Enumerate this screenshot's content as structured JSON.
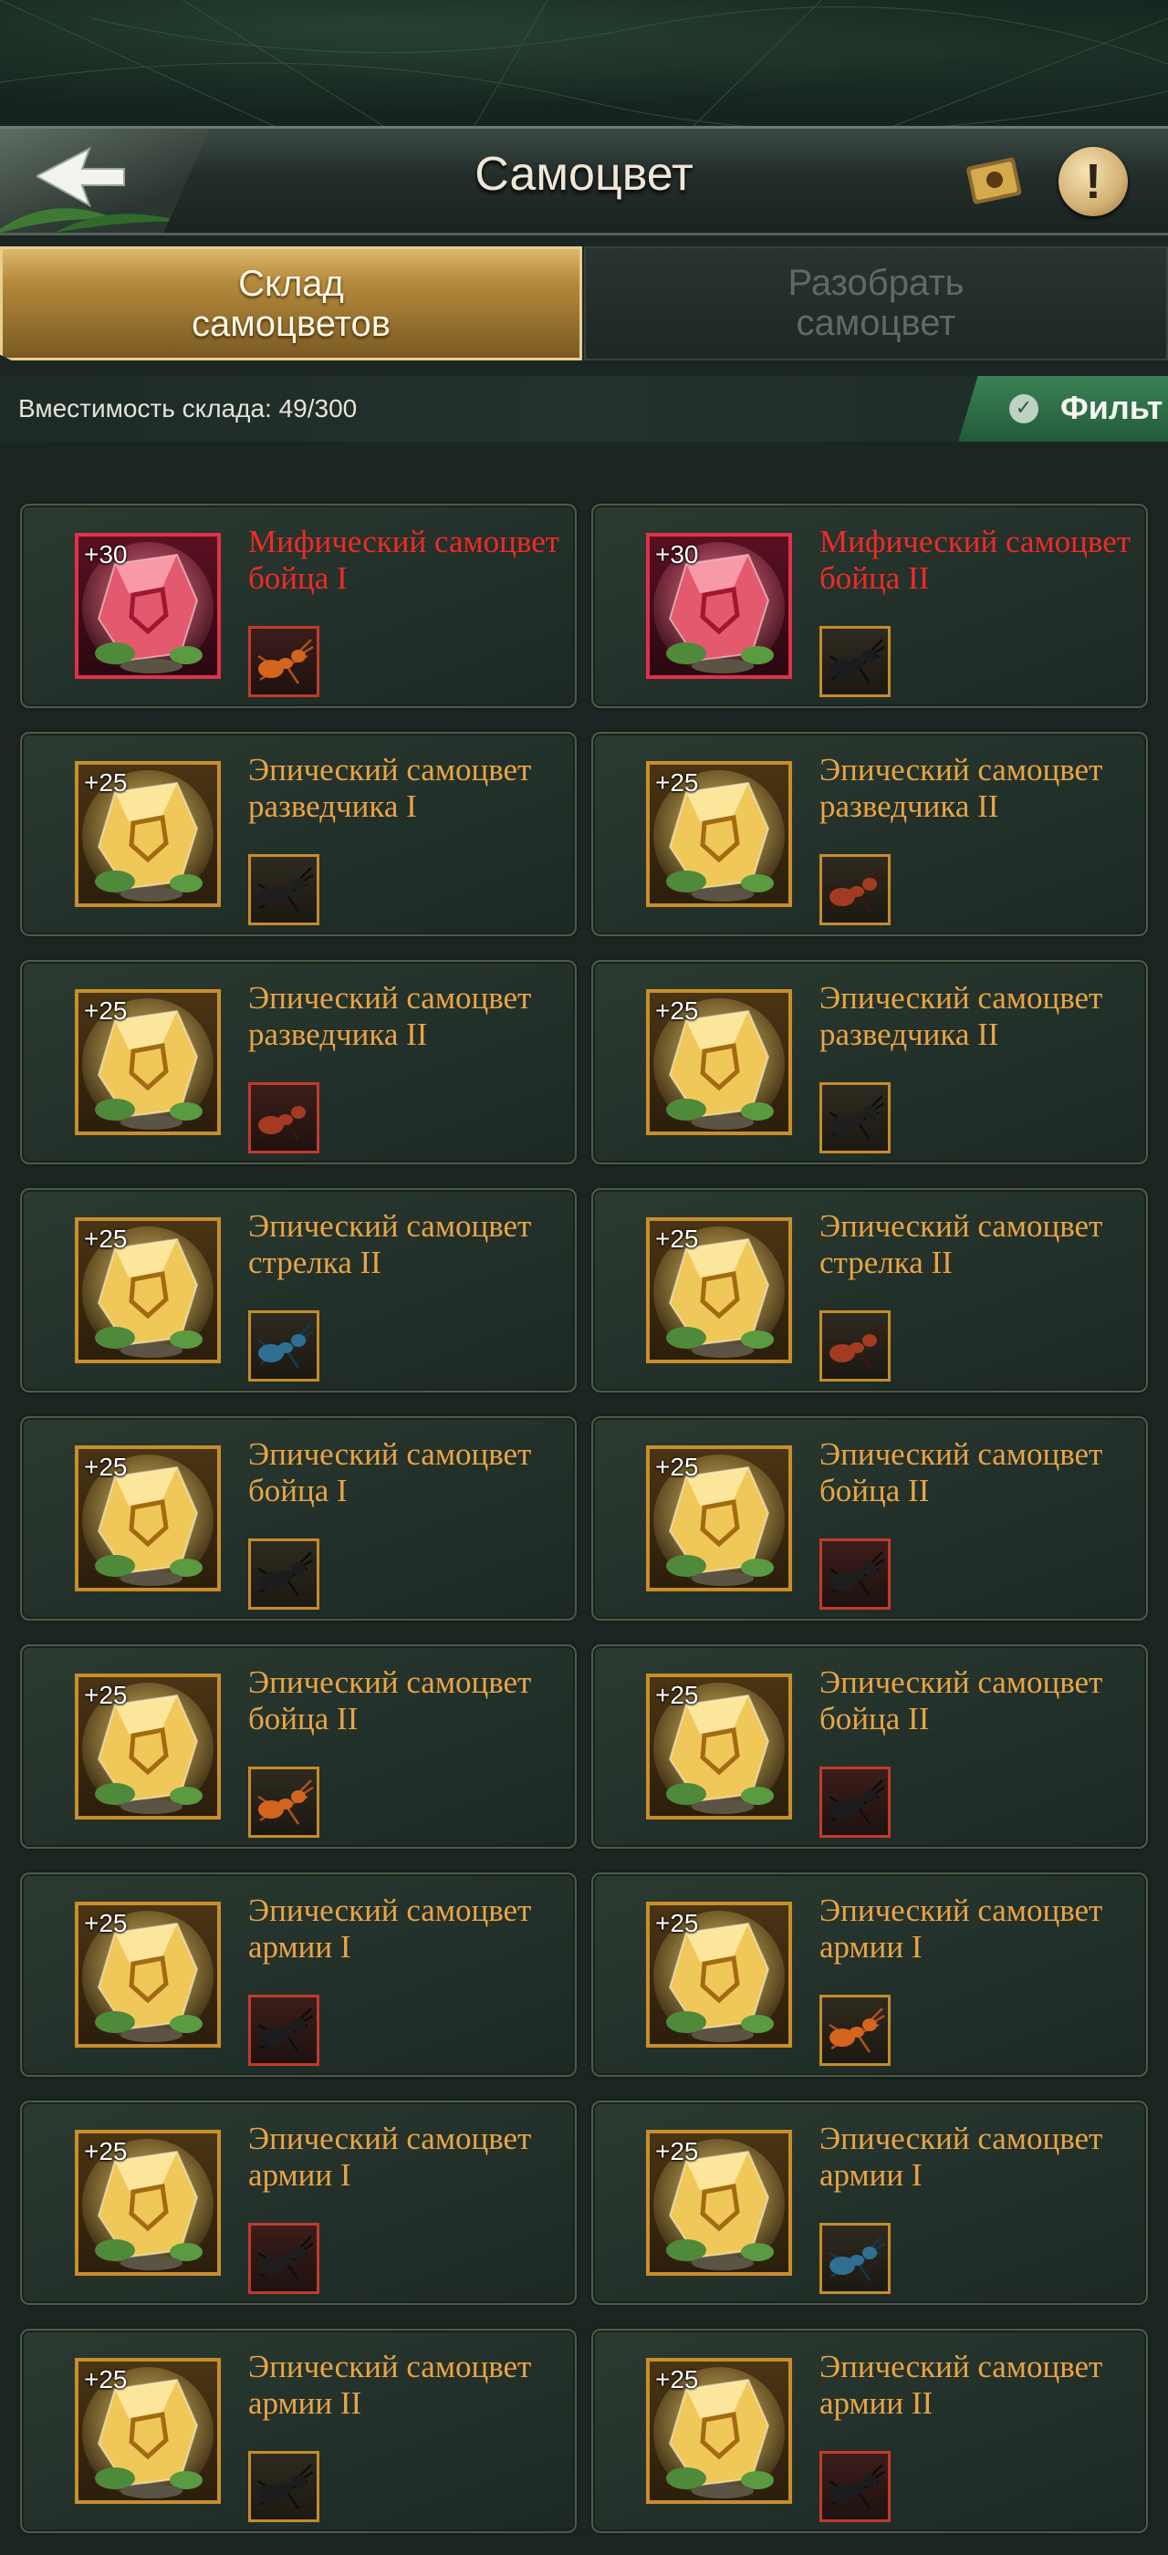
{
  "header": {
    "title": "Самоцвет"
  },
  "tabs": [
    {
      "label": "Склад\nсамоцветов",
      "active": true
    },
    {
      "label": "Разобрать\nсамоцвет",
      "active": false
    }
  ],
  "storage": {
    "capacity_text": "Вместимость склада: 49/300"
  },
  "filter": {
    "label": "Фильт"
  },
  "colors": {
    "epic": "#e9a445",
    "mythic": "#ef2a26",
    "tab_gold": "#c9a050",
    "filter_green": "#2e6e48"
  },
  "gems": [
    {
      "level": "+30",
      "name": "Мифический самоцвет бойца I",
      "rarity": "mythic",
      "insect_frame": "red",
      "insect": "orange-ant"
    },
    {
      "level": "+30",
      "name": "Мифический самоцвет бойца II",
      "rarity": "mythic",
      "insect_frame": "gold",
      "insect": "black-beetle"
    },
    {
      "level": "+25",
      "name": "Эпический самоцвет разведчика I",
      "rarity": "epic",
      "insect_frame": "gold",
      "insect": "black-ant"
    },
    {
      "level": "+25",
      "name": "Эпический самоцвет разведчика II",
      "rarity": "epic",
      "insect_frame": "gold",
      "insect": "red-ant"
    },
    {
      "level": "+25",
      "name": "Эпический самоцвет разведчика II",
      "rarity": "epic",
      "insect_frame": "red",
      "insect": "red-ant"
    },
    {
      "level": "+25",
      "name": "Эпический самоцвет разведчика II",
      "rarity": "epic",
      "insect_frame": "gold",
      "insect": "black-ant"
    },
    {
      "level": "+25",
      "name": "Эпический самоцвет стрелка II",
      "rarity": "epic",
      "insect_frame": "gold",
      "insect": "blue-beetle"
    },
    {
      "level": "+25",
      "name": "Эпический самоцвет стрелка II",
      "rarity": "epic",
      "insect_frame": "gold",
      "insect": "red-ant"
    },
    {
      "level": "+25",
      "name": "Эпический самоцвет бойца I",
      "rarity": "epic",
      "insect_frame": "gold",
      "insect": "black-beetle"
    },
    {
      "level": "+25",
      "name": "Эпический самоцвет бойца II",
      "rarity": "epic",
      "insect_frame": "red",
      "insect": "black-ant"
    },
    {
      "level": "+25",
      "name": "Эпический самоцвет бойца II",
      "rarity": "epic",
      "insect_frame": "gold",
      "insect": "orange-ant"
    },
    {
      "level": "+25",
      "name": "Эпический самоцвет бойца II",
      "rarity": "epic",
      "insect_frame": "red",
      "insect": "black-beetle"
    },
    {
      "level": "+25",
      "name": "Эпический самоцвет армии I",
      "rarity": "epic",
      "insect_frame": "red",
      "insect": "black-beetle"
    },
    {
      "level": "+25",
      "name": "Эпический самоцвет армии I",
      "rarity": "epic",
      "insect_frame": "gold",
      "insect": "orange-ant"
    },
    {
      "level": "+25",
      "name": "Эпический самоцвет армии I",
      "rarity": "epic",
      "insect_frame": "red",
      "insect": "black-ant"
    },
    {
      "level": "+25",
      "name": "Эпический самоцвет армии I",
      "rarity": "epic",
      "insect_frame": "gold",
      "insect": "blue-beetle"
    },
    {
      "level": "+25",
      "name": "Эпический самоцвет армии II",
      "rarity": "epic",
      "insect_frame": "gold",
      "insect": "black-beetle"
    },
    {
      "level": "+25",
      "name": "Эпический самоцвет армии II",
      "rarity": "epic",
      "insect_frame": "red",
      "insect": "black-beetle"
    }
  ]
}
